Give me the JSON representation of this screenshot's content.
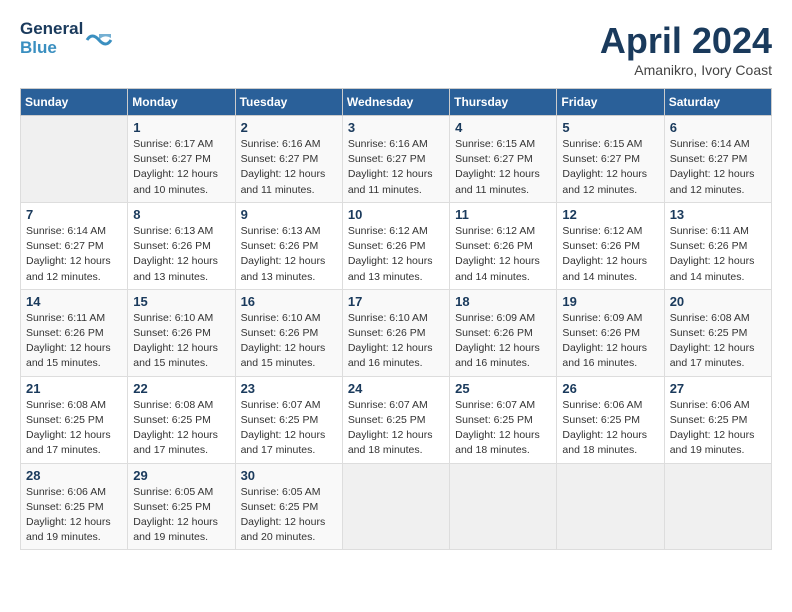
{
  "header": {
    "logo_line1": "General",
    "logo_line2": "Blue",
    "month_year": "April 2024",
    "location": "Amanikro, Ivory Coast"
  },
  "weekdays": [
    "Sunday",
    "Monday",
    "Tuesday",
    "Wednesday",
    "Thursday",
    "Friday",
    "Saturday"
  ],
  "weeks": [
    [
      {
        "day": "",
        "sunrise": "",
        "sunset": "",
        "daylight": ""
      },
      {
        "day": "1",
        "sunrise": "Sunrise: 6:17 AM",
        "sunset": "Sunset: 6:27 PM",
        "daylight": "Daylight: 12 hours and 10 minutes."
      },
      {
        "day": "2",
        "sunrise": "Sunrise: 6:16 AM",
        "sunset": "Sunset: 6:27 PM",
        "daylight": "Daylight: 12 hours and 11 minutes."
      },
      {
        "day": "3",
        "sunrise": "Sunrise: 6:16 AM",
        "sunset": "Sunset: 6:27 PM",
        "daylight": "Daylight: 12 hours and 11 minutes."
      },
      {
        "day": "4",
        "sunrise": "Sunrise: 6:15 AM",
        "sunset": "Sunset: 6:27 PM",
        "daylight": "Daylight: 12 hours and 11 minutes."
      },
      {
        "day": "5",
        "sunrise": "Sunrise: 6:15 AM",
        "sunset": "Sunset: 6:27 PM",
        "daylight": "Daylight: 12 hours and 12 minutes."
      },
      {
        "day": "6",
        "sunrise": "Sunrise: 6:14 AM",
        "sunset": "Sunset: 6:27 PM",
        "daylight": "Daylight: 12 hours and 12 minutes."
      }
    ],
    [
      {
        "day": "7",
        "sunrise": "Sunrise: 6:14 AM",
        "sunset": "Sunset: 6:27 PM",
        "daylight": "Daylight: 12 hours and 12 minutes."
      },
      {
        "day": "8",
        "sunrise": "Sunrise: 6:13 AM",
        "sunset": "Sunset: 6:26 PM",
        "daylight": "Daylight: 12 hours and 13 minutes."
      },
      {
        "day": "9",
        "sunrise": "Sunrise: 6:13 AM",
        "sunset": "Sunset: 6:26 PM",
        "daylight": "Daylight: 12 hours and 13 minutes."
      },
      {
        "day": "10",
        "sunrise": "Sunrise: 6:12 AM",
        "sunset": "Sunset: 6:26 PM",
        "daylight": "Daylight: 12 hours and 13 minutes."
      },
      {
        "day": "11",
        "sunrise": "Sunrise: 6:12 AM",
        "sunset": "Sunset: 6:26 PM",
        "daylight": "Daylight: 12 hours and 14 minutes."
      },
      {
        "day": "12",
        "sunrise": "Sunrise: 6:12 AM",
        "sunset": "Sunset: 6:26 PM",
        "daylight": "Daylight: 12 hours and 14 minutes."
      },
      {
        "day": "13",
        "sunrise": "Sunrise: 6:11 AM",
        "sunset": "Sunset: 6:26 PM",
        "daylight": "Daylight: 12 hours and 14 minutes."
      }
    ],
    [
      {
        "day": "14",
        "sunrise": "Sunrise: 6:11 AM",
        "sunset": "Sunset: 6:26 PM",
        "daylight": "Daylight: 12 hours and 15 minutes."
      },
      {
        "day": "15",
        "sunrise": "Sunrise: 6:10 AM",
        "sunset": "Sunset: 6:26 PM",
        "daylight": "Daylight: 12 hours and 15 minutes."
      },
      {
        "day": "16",
        "sunrise": "Sunrise: 6:10 AM",
        "sunset": "Sunset: 6:26 PM",
        "daylight": "Daylight: 12 hours and 15 minutes."
      },
      {
        "day": "17",
        "sunrise": "Sunrise: 6:10 AM",
        "sunset": "Sunset: 6:26 PM",
        "daylight": "Daylight: 12 hours and 16 minutes."
      },
      {
        "day": "18",
        "sunrise": "Sunrise: 6:09 AM",
        "sunset": "Sunset: 6:26 PM",
        "daylight": "Daylight: 12 hours and 16 minutes."
      },
      {
        "day": "19",
        "sunrise": "Sunrise: 6:09 AM",
        "sunset": "Sunset: 6:26 PM",
        "daylight": "Daylight: 12 hours and 16 minutes."
      },
      {
        "day": "20",
        "sunrise": "Sunrise: 6:08 AM",
        "sunset": "Sunset: 6:25 PM",
        "daylight": "Daylight: 12 hours and 17 minutes."
      }
    ],
    [
      {
        "day": "21",
        "sunrise": "Sunrise: 6:08 AM",
        "sunset": "Sunset: 6:25 PM",
        "daylight": "Daylight: 12 hours and 17 minutes."
      },
      {
        "day": "22",
        "sunrise": "Sunrise: 6:08 AM",
        "sunset": "Sunset: 6:25 PM",
        "daylight": "Daylight: 12 hours and 17 minutes."
      },
      {
        "day": "23",
        "sunrise": "Sunrise: 6:07 AM",
        "sunset": "Sunset: 6:25 PM",
        "daylight": "Daylight: 12 hours and 17 minutes."
      },
      {
        "day": "24",
        "sunrise": "Sunrise: 6:07 AM",
        "sunset": "Sunset: 6:25 PM",
        "daylight": "Daylight: 12 hours and 18 minutes."
      },
      {
        "day": "25",
        "sunrise": "Sunrise: 6:07 AM",
        "sunset": "Sunset: 6:25 PM",
        "daylight": "Daylight: 12 hours and 18 minutes."
      },
      {
        "day": "26",
        "sunrise": "Sunrise: 6:06 AM",
        "sunset": "Sunset: 6:25 PM",
        "daylight": "Daylight: 12 hours and 18 minutes."
      },
      {
        "day": "27",
        "sunrise": "Sunrise: 6:06 AM",
        "sunset": "Sunset: 6:25 PM",
        "daylight": "Daylight: 12 hours and 19 minutes."
      }
    ],
    [
      {
        "day": "28",
        "sunrise": "Sunrise: 6:06 AM",
        "sunset": "Sunset: 6:25 PM",
        "daylight": "Daylight: 12 hours and 19 minutes."
      },
      {
        "day": "29",
        "sunrise": "Sunrise: 6:05 AM",
        "sunset": "Sunset: 6:25 PM",
        "daylight": "Daylight: 12 hours and 19 minutes."
      },
      {
        "day": "30",
        "sunrise": "Sunrise: 6:05 AM",
        "sunset": "Sunset: 6:25 PM",
        "daylight": "Daylight: 12 hours and 20 minutes."
      },
      {
        "day": "",
        "sunrise": "",
        "sunset": "",
        "daylight": ""
      },
      {
        "day": "",
        "sunrise": "",
        "sunset": "",
        "daylight": ""
      },
      {
        "day": "",
        "sunrise": "",
        "sunset": "",
        "daylight": ""
      },
      {
        "day": "",
        "sunrise": "",
        "sunset": "",
        "daylight": ""
      }
    ]
  ]
}
